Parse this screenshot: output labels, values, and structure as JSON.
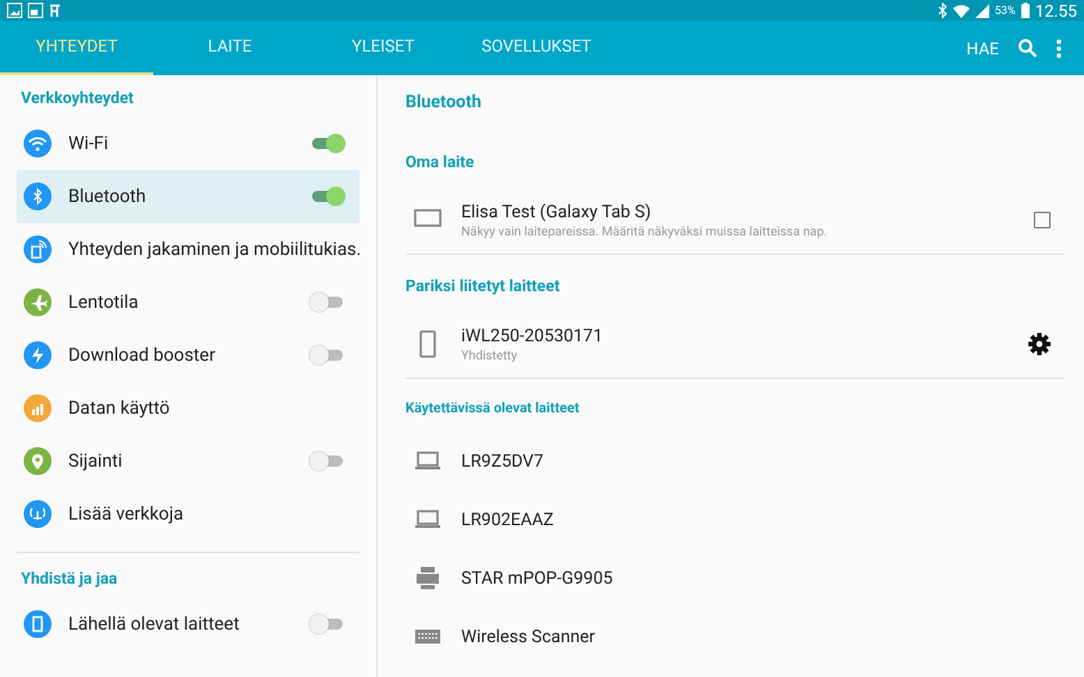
{
  "status_bar": {
    "battery": "53%",
    "time": "12.55"
  },
  "tabs": [
    {
      "label": "YHTEYDET",
      "selected": true
    },
    {
      "label": "LAITE",
      "selected": false
    },
    {
      "label": "YLEISET",
      "selected": false
    },
    {
      "label": "SOVELLUKSET",
      "selected": false
    }
  ],
  "search_label": "HAE",
  "sidebar": {
    "sections": [
      {
        "title": "Verkkoyhteydet",
        "items": [
          {
            "label": "Wi-Fi",
            "kind": "wifi",
            "color": "#2196f3",
            "on": true,
            "selected": false
          },
          {
            "label": "Bluetooth",
            "kind": "bluetooth",
            "color": "#2196f3",
            "on": true,
            "selected": true
          },
          {
            "label": "Yhteyden jakaminen ja mobiilitukias.",
            "kind": "hotspot",
            "color": "#2196f3",
            "selected": false
          },
          {
            "label": "Lentotila",
            "kind": "plane",
            "color": "#7cb342",
            "on": false,
            "selected": false
          },
          {
            "label": "Download booster",
            "kind": "bolt",
            "color": "#2196f3",
            "on": false,
            "selected": false
          },
          {
            "label": "Datan käyttö",
            "kind": "bars",
            "color": "#f4a83a",
            "selected": false
          },
          {
            "label": "Sijainti",
            "kind": "pin",
            "color": "#7cb342",
            "on": false,
            "selected": false
          },
          {
            "label": "Lisää verkkoja",
            "kind": "antenna",
            "color": "#2196f3",
            "selected": false
          }
        ]
      },
      {
        "title": "Yhdistä ja jaa",
        "items": [
          {
            "label": "Lähellä olevat laitteet",
            "kind": "device",
            "color": "#2196f3",
            "on": false,
            "selected": false
          }
        ]
      }
    ]
  },
  "detail": {
    "title": "Bluetooth",
    "sections": [
      {
        "title": "Oma laite",
        "devices": [
          {
            "name": "Elisa Test (Galaxy Tab S)",
            "subtitle": "Näkyy vain laitepareissa. Määritä näkyväksi muissa laitteissa nap.",
            "kind": "tablet",
            "checked": false
          }
        ]
      },
      {
        "title": "Pariksi liitetyt laitteet",
        "devices": [
          {
            "name": "iWL250-20530171",
            "subtitle": "Yhdistetty",
            "kind": "phone"
          }
        ]
      },
      {
        "title": "Käytettävissä olevat laitteet",
        "devices": [
          {
            "name": "LR9Z5DV7",
            "kind": "laptop"
          },
          {
            "name": "LR902EAAZ",
            "kind": "laptop"
          },
          {
            "name": "STAR mPOP-G9905",
            "kind": "printer"
          },
          {
            "name": "Wireless Scanner",
            "kind": "keyboard"
          }
        ]
      }
    ]
  }
}
